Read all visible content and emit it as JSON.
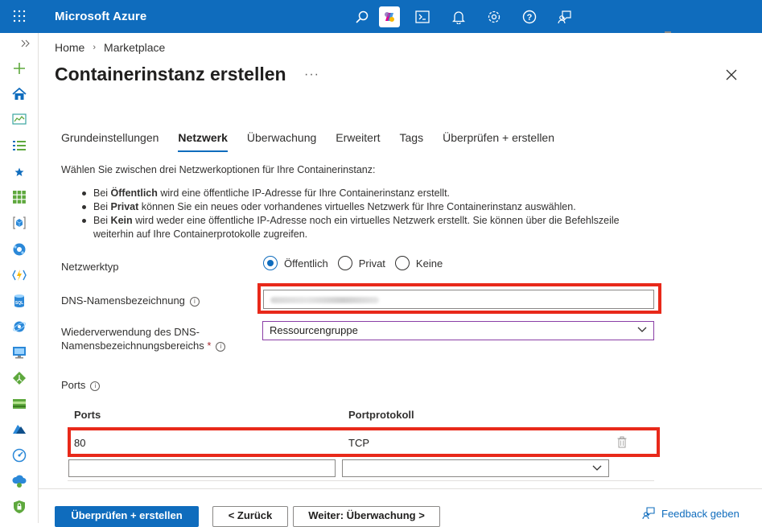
{
  "topbar": {
    "brand": "Microsoft Azure"
  },
  "breadcrumb": {
    "home": "Home",
    "marketplace": "Marketplace",
    "separator": "›"
  },
  "page": {
    "title": "Containerinstanz erstellen",
    "more": "···"
  },
  "tabs": [
    {
      "label": "Grundeinstellungen"
    },
    {
      "label": "Netzwerk"
    },
    {
      "label": "Überwachung"
    },
    {
      "label": "Erweitert"
    },
    {
      "label": "Tags"
    },
    {
      "label": "Überprüfen + erstellen"
    }
  ],
  "intro": "Wählen Sie zwischen drei Netzwerkoptionen für Ihre Containerinstanz:",
  "bullets": [
    {
      "pre": "Bei ",
      "bold": "Öffentlich",
      "post": " wird eine öffentliche IP-Adresse für Ihre Containerinstanz erstellt."
    },
    {
      "pre": "Bei ",
      "bold": "Privat",
      "post": " können Sie ein neues oder vorhandenes virtuelles Netzwerk für Ihre Containerinstanz auswählen."
    },
    {
      "pre": "Bei ",
      "bold": "Kein",
      "post": " wird weder eine öffentliche IP-Adresse noch ein virtuelles Netzwerk erstellt. Sie können über die Befehlszeile weiterhin auf Ihre Containerprotokolle zugreifen."
    }
  ],
  "form": {
    "network_type_label": "Netzwerktyp",
    "options": [
      "Öffentlich",
      "Privat",
      "Keine"
    ],
    "selected_option": "Öffentlich",
    "dns_label": "DNS-Namensbezeichnung",
    "reuse_label_line1": "Wiederverwendung des DNS-",
    "reuse_label_line2": "Namensbezeichnungsbereichs",
    "required_mark": "*",
    "reuse_value": "Ressourcengruppe",
    "ports_label": "Ports",
    "info": "i"
  },
  "ports_table": {
    "headers": [
      "Ports",
      "Portprotokoll"
    ],
    "rows": [
      {
        "port": "80",
        "protocol": "TCP"
      }
    ]
  },
  "footer": {
    "review_create": "Überprüfen + erstellen",
    "back": "< Zurück",
    "next": "Weiter: Überwachung >",
    "feedback": "Feedback geben"
  },
  "colors": {
    "accent": "#0f6cbd",
    "highlight": "#e8291a"
  }
}
